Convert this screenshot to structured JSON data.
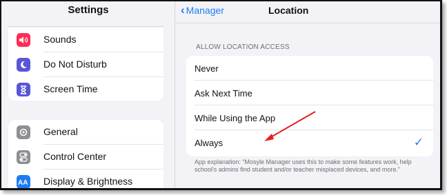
{
  "sidebar": {
    "title": "Settings",
    "group1": [
      {
        "label": "Sounds",
        "icon": "speaker-icon",
        "color": "#ff2d55"
      },
      {
        "label": "Do Not Disturb",
        "icon": "moon-icon",
        "color": "#5856d6"
      },
      {
        "label": "Screen Time",
        "icon": "hourglass-icon",
        "color": "#5856d6"
      }
    ],
    "group2": [
      {
        "label": "General",
        "icon": "gear-icon",
        "color": "#8e8e93"
      },
      {
        "label": "Control Center",
        "icon": "toggles-icon",
        "color": "#8e8e93"
      },
      {
        "label": "Display & Brightness",
        "icon": "aa-icon",
        "color": "#1e7cf2"
      }
    ]
  },
  "detail": {
    "back_label": "Manager",
    "title": "Location",
    "section_header": "ALLOW LOCATION ACCESS",
    "options": [
      {
        "label": "Never",
        "selected": false
      },
      {
        "label": "Ask Next Time",
        "selected": false
      },
      {
        "label": "While Using the App",
        "selected": false
      },
      {
        "label": "Always",
        "selected": true
      }
    ],
    "checkmark": "✓",
    "explanation": "App explanation: “Mosyle Manager uses this to make some features work, help school's admins find student and/or teacher misplaced devices, and more.”"
  },
  "annotation": {
    "color": "#e02020"
  }
}
